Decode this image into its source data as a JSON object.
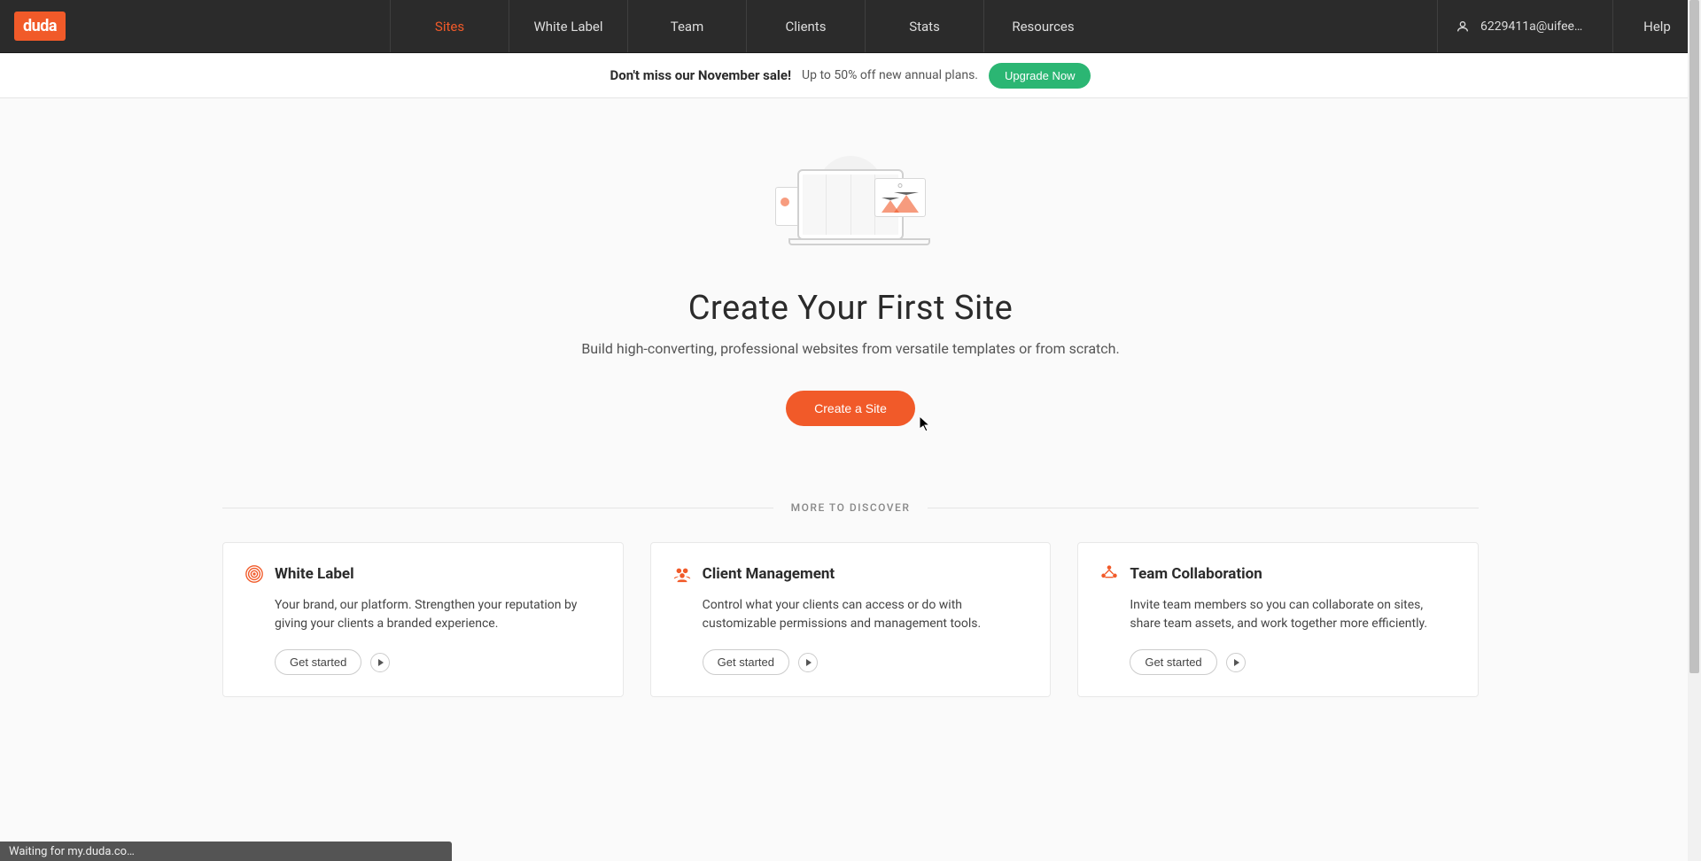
{
  "header": {
    "logo": "duda",
    "nav": {
      "items": [
        {
          "label": "Sites",
          "active": true
        },
        {
          "label": "White Label",
          "active": false
        },
        {
          "label": "Team",
          "active": false
        },
        {
          "label": "Clients",
          "active": false
        },
        {
          "label": "Stats",
          "active": false
        },
        {
          "label": "Resources",
          "active": false
        }
      ]
    },
    "user_email": "6229411a@uifee…",
    "help_label": "Help"
  },
  "promo": {
    "bold_text": "Don't miss our November sale!",
    "detail_text": "Up to 50% off new annual plans.",
    "button_label": "Upgrade Now"
  },
  "hero": {
    "title": "Create Your First Site",
    "subtitle": "Build high-converting, professional websites from versatile templates or from scratch.",
    "button_label": "Create a Site"
  },
  "divider_text": "MORE TO DISCOVER",
  "cards": [
    {
      "title": "White Label",
      "description": "Your brand, our platform. Strengthen your reputation by giving your clients a branded experience.",
      "button_label": "Get started"
    },
    {
      "title": "Client Management",
      "description": "Control what your clients can access or do with customizable permissions and management tools.",
      "button_label": "Get started"
    },
    {
      "title": "Team Collaboration",
      "description": "Invite team members so you can collaborate on sites, share team assets, and work together more efficiently.",
      "button_label": "Get started"
    }
  ],
  "status_bar": "Waiting for my.duda.co…"
}
